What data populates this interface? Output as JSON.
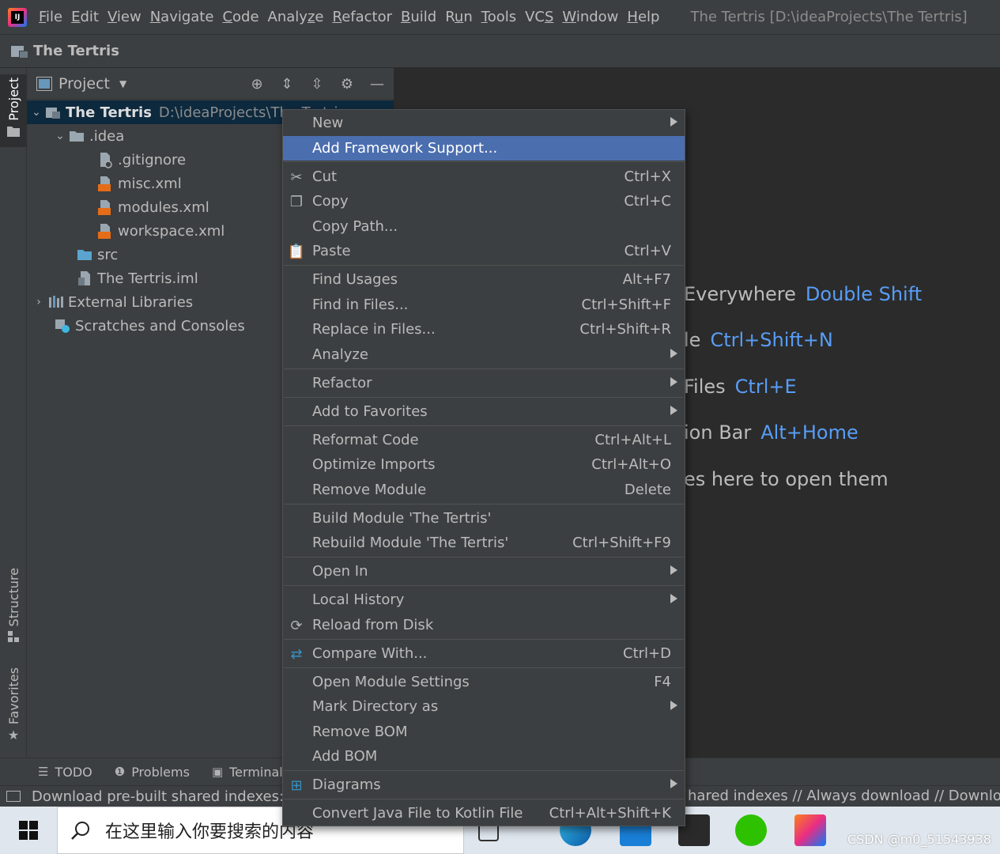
{
  "menubar": {
    "items": [
      {
        "pre": "",
        "u": "F",
        "post": "ile"
      },
      {
        "pre": "",
        "u": "E",
        "post": "dit"
      },
      {
        "pre": "",
        "u": "V",
        "post": "iew"
      },
      {
        "pre": "",
        "u": "N",
        "post": "avigate"
      },
      {
        "pre": "",
        "u": "C",
        "post": "ode"
      },
      {
        "pre": "Analy",
        "u": "z",
        "post": "e"
      },
      {
        "pre": "",
        "u": "R",
        "post": "efactor"
      },
      {
        "pre": "",
        "u": "B",
        "post": "uild"
      },
      {
        "pre": "R",
        "u": "u",
        "post": "n"
      },
      {
        "pre": "",
        "u": "T",
        "post": "ools"
      },
      {
        "pre": "VC",
        "u": "S",
        "post": ""
      },
      {
        "pre": "",
        "u": "W",
        "post": "indow"
      },
      {
        "pre": "",
        "u": "H",
        "post": "elp"
      }
    ],
    "window_title": "The Tertris [D:\\ideaProjects\\The Tertris]"
  },
  "navbar": {
    "project": "The Tertris"
  },
  "left_strip": {
    "project_tab": "Project",
    "structure_tab": "Structure",
    "favorites_tab": "Favorites"
  },
  "project_panel": {
    "title": "Project",
    "tree": [
      {
        "label": "The Tertris",
        "path": "D:\\ideaProjects\\The Tertris"
      },
      {
        "label": ".idea"
      },
      {
        "label": ".gitignore"
      },
      {
        "label": "misc.xml"
      },
      {
        "label": "modules.xml"
      },
      {
        "label": "workspace.xml"
      },
      {
        "label": "src"
      },
      {
        "label": "The Tertris.iml"
      },
      {
        "label": "External Libraries"
      },
      {
        "label": "Scratches and Consoles"
      }
    ]
  },
  "welcome": {
    "hints": [
      {
        "text": "Everywhere",
        "key": "Double Shift"
      },
      {
        "text": "le",
        "key": "Ctrl+Shift+N"
      },
      {
        "text": "Files",
        "key": "Ctrl+E"
      },
      {
        "text": "ion Bar",
        "key": "Alt+Home"
      },
      {
        "text": "es here to open them",
        "key": ""
      }
    ]
  },
  "bottom_tools": {
    "todo": "TODO",
    "problems": "Problems",
    "terminal": "Terminal"
  },
  "statusbar": {
    "left": "Download pre-built shared indexes: Reduce the indexing time and CPU load with pre-built JDK shared indexes",
    "right": "hared indexes // Always download // Download once"
  },
  "context_menu": {
    "items": [
      {
        "label": "New",
        "u": "",
        "shortcut": "",
        "submenu": true
      },
      {
        "label": "Add Framework Support...",
        "shortcut": "",
        "submenu": false
      },
      {
        "label": "Cut",
        "shortcut": "Ctrl+X",
        "submenu": false,
        "icon": "cut-icon"
      },
      {
        "label": "Copy",
        "shortcut": "Ctrl+C",
        "submenu": false,
        "icon": "copy-icon"
      },
      {
        "label": "Copy Path...",
        "shortcut": "",
        "submenu": false
      },
      {
        "label": "Paste",
        "shortcut": "Ctrl+V",
        "submenu": false,
        "icon": "paste-icon"
      },
      {
        "label": "Find Usages",
        "shortcut": "Alt+F7",
        "submenu": false
      },
      {
        "label": "Find in Files...",
        "shortcut": "Ctrl+Shift+F",
        "submenu": false
      },
      {
        "label": "Replace in Files...",
        "shortcut": "Ctrl+Shift+R",
        "submenu": false
      },
      {
        "label": "Analyze",
        "shortcut": "",
        "submenu": true
      },
      {
        "label": "Refactor",
        "shortcut": "",
        "submenu": true
      },
      {
        "label": "Add to Favorites",
        "shortcut": "",
        "submenu": true
      },
      {
        "label": "Reformat Code",
        "shortcut": "Ctrl+Alt+L",
        "submenu": false
      },
      {
        "label": "Optimize Imports",
        "shortcut": "Ctrl+Alt+O",
        "submenu": false
      },
      {
        "label": "Remove Module",
        "shortcut": "Delete",
        "submenu": false
      },
      {
        "label": "Build Module 'The Tertris'",
        "shortcut": "",
        "submenu": false
      },
      {
        "label": "Rebuild Module 'The Tertris'",
        "shortcut": "Ctrl+Shift+F9",
        "submenu": false
      },
      {
        "label": "Open In",
        "shortcut": "",
        "submenu": true
      },
      {
        "label": "Local History",
        "shortcut": "",
        "submenu": true
      },
      {
        "label": "Reload from Disk",
        "shortcut": "",
        "submenu": false,
        "icon": "reload-icon"
      },
      {
        "label": "Compare With...",
        "shortcut": "Ctrl+D",
        "submenu": false,
        "icon": "compare-icon"
      },
      {
        "label": "Open Module Settings",
        "shortcut": "F4",
        "submenu": false
      },
      {
        "label": "Mark Directory as",
        "shortcut": "",
        "submenu": true
      },
      {
        "label": "Remove BOM",
        "shortcut": "",
        "submenu": false
      },
      {
        "label": "Add BOM",
        "shortcut": "",
        "submenu": false
      },
      {
        "label": "Diagrams",
        "shortcut": "",
        "submenu": true,
        "icon": "diagrams-icon"
      },
      {
        "label": "Convert Java File to Kotlin File",
        "shortcut": "Ctrl+Alt+Shift+K",
        "submenu": false
      }
    ]
  },
  "taskbar": {
    "search_placeholder": "在这里输入你要搜索的内容",
    "watermark": "CSDN @m0_51543938"
  },
  "colors": {
    "accent": "#4b6eaf",
    "link": "#589df6",
    "bg": "#2b2b2b",
    "panel": "#3c3f41"
  }
}
